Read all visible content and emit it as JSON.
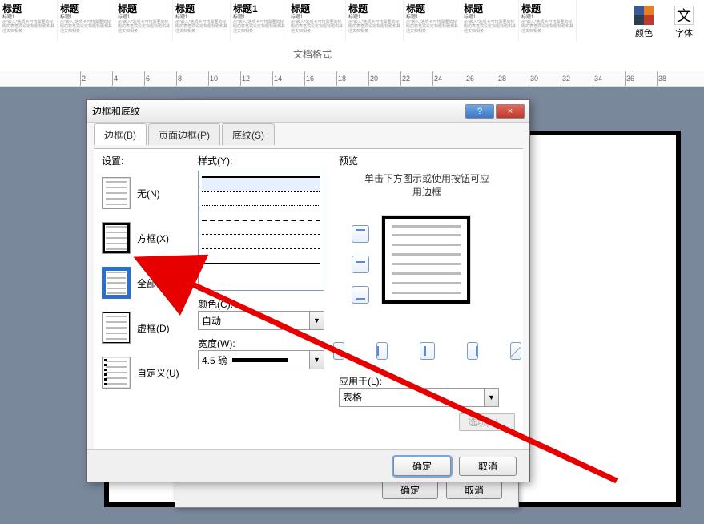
{
  "ribbon": {
    "styles": [
      "标题",
      "标题",
      "标题",
      "标题",
      "标题1",
      "标题",
      "标题",
      "标题",
      "标题",
      "标题"
    ],
    "sub1": "标题1",
    "caption": "文档格式",
    "color_label": "颜色",
    "font_label": "字体",
    "font_glyph": "文"
  },
  "ruler_ticks": [
    2,
    4,
    6,
    8,
    10,
    12,
    14,
    16,
    18,
    20,
    22,
    24,
    26,
    28,
    30,
    32,
    34,
    36,
    38
  ],
  "back_dialog": {
    "ok": "确定",
    "cancel": "取消"
  },
  "dialog": {
    "title": "边框和底纹",
    "help": "?",
    "close": "×",
    "tabs": {
      "border": "边框(B)",
      "page_border": "页面边框(P)",
      "shading": "底纹(S)"
    },
    "setting_label": "设置:",
    "settings": {
      "none": "无(N)",
      "box": "方框(X)",
      "all": "全部(A)",
      "grid": "虚框(D)",
      "custom": "自定义(U)"
    },
    "style_label": "样式(Y):",
    "color_label": "颜色(C):",
    "color_value": "自动",
    "width_label": "宽度(W):",
    "width_value": "4.5 磅",
    "preview_label": "预览",
    "preview_hint": "单击下方图示或使用按钮可应用边框",
    "apply_label": "应用于(L):",
    "apply_value": "表格",
    "options": "选项(O)...",
    "ok": "确定",
    "cancel": "取消"
  }
}
